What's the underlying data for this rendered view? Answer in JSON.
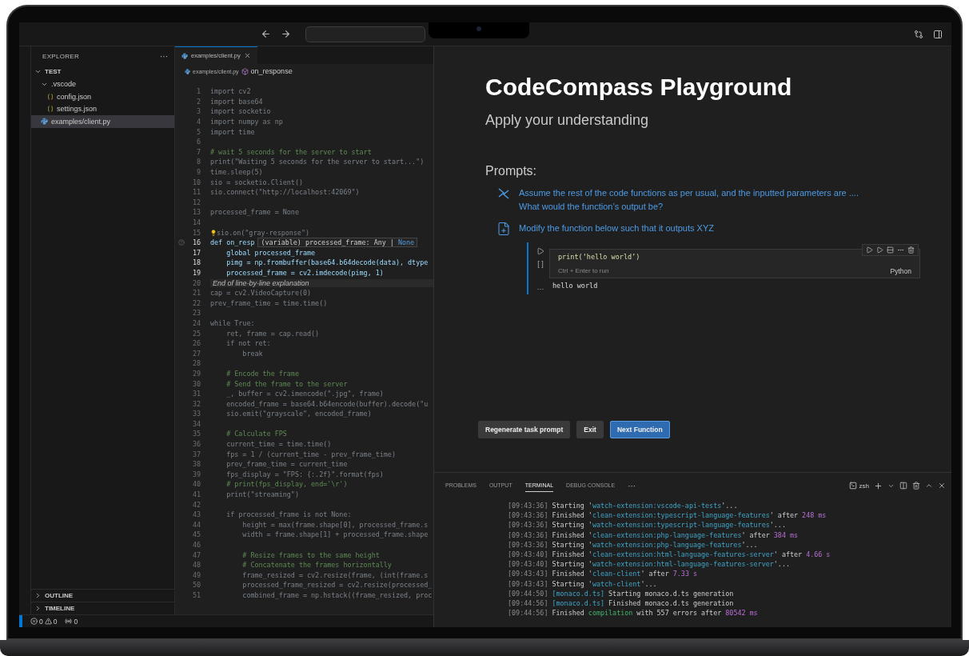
{
  "explorer": {
    "title": "EXPLORER",
    "more": "···",
    "tree": [
      {
        "label": "TEST",
        "kind": "root",
        "expanded": true,
        "selected": false,
        "children": [
          {
            "label": ".vscode",
            "kind": "folder",
            "expanded": true,
            "selected": false,
            "children": [
              {
                "label": "config.json",
                "kind": "json",
                "selected": false
              },
              {
                "label": "settings.json",
                "kind": "json",
                "selected": false
              }
            ]
          },
          {
            "label": "examples/client.py",
            "kind": "python",
            "selected": true
          }
        ]
      }
    ],
    "sections": [
      {
        "label": "OUTLINE",
        "expanded": false
      },
      {
        "label": "TIMELINE",
        "expanded": false
      }
    ]
  },
  "status_bar": {
    "errors": "0",
    "warnings": "0",
    "ports": "0"
  },
  "editor": {
    "tab": {
      "label": "examples/client.py",
      "selected": true
    },
    "breadcrumb": {
      "file": "examples/client.py",
      "symbol": "on_response"
    },
    "lines": [
      {
        "n": "1",
        "text": "import cv2",
        "kind": "code",
        "focus": false
      },
      {
        "n": "2",
        "text": "import base64",
        "kind": "code",
        "focus": false
      },
      {
        "n": "3",
        "text": "import socketio",
        "kind": "code",
        "focus": false
      },
      {
        "n": "4",
        "text": "import numpy as np",
        "kind": "code",
        "focus": false
      },
      {
        "n": "5",
        "text": "import time",
        "kind": "code",
        "focus": false
      },
      {
        "n": "6",
        "kind": "blank",
        "focus": false
      },
      {
        "n": "7",
        "text": "# wait 5 seconds for the server to start",
        "kind": "comment",
        "focus": false
      },
      {
        "n": "8",
        "text": "print(\"Waiting 5 seconds for the server to start...\")",
        "kind": "code",
        "focus": false
      },
      {
        "n": "9",
        "text": "time.sleep(5)",
        "kind": "code",
        "focus": false
      },
      {
        "n": "10",
        "text": "sio = socketio.Client()",
        "kind": "code",
        "focus": false
      },
      {
        "n": "11",
        "text": "sio.connect(\"http://localhost:42069\")",
        "kind": "code",
        "focus": false
      },
      {
        "n": "12",
        "kind": "blank",
        "focus": false
      },
      {
        "n": "13",
        "text": "processed_frame = None",
        "kind": "code",
        "focus": false
      },
      {
        "n": "14",
        "kind": "blank",
        "focus": false
      },
      {
        "n": "15",
        "text": "sio.on(\"gray-response\")",
        "kind": "bulb",
        "focus": false
      },
      {
        "n": "16",
        "text": "def on_resp",
        "kind": "hover",
        "focus": true,
        "hover_sig": "(variable) processed_frame: Any | ",
        "hover_type": "None"
      },
      {
        "n": "17",
        "text": "    global processed_frame",
        "kind": "code",
        "focus": true
      },
      {
        "n": "18",
        "text": "    pimg = np.frombuffer(base64.b64decode(data), dtype",
        "kind": "code",
        "focus": true
      },
      {
        "n": "19",
        "text": "    processed_frame = cv2.imdecode(pimg, 1)",
        "kind": "code",
        "focus": true
      },
      {
        "n": "20",
        "text": "End of line-by-line explanation",
        "kind": "banner",
        "focus": false
      },
      {
        "n": "21",
        "text": "cap = cv2.VideoCapture(0)",
        "kind": "code",
        "focus": false
      },
      {
        "n": "22",
        "text": "prev_frame_time = time.time()",
        "kind": "code",
        "focus": false
      },
      {
        "n": "23",
        "kind": "blank",
        "focus": false
      },
      {
        "n": "24",
        "text": "while True:",
        "kind": "code",
        "focus": false
      },
      {
        "n": "25",
        "text": "    ret, frame = cap.read()",
        "kind": "code",
        "focus": false
      },
      {
        "n": "26",
        "text": "    if not ret:",
        "kind": "code",
        "focus": false
      },
      {
        "n": "27",
        "text": "        break",
        "kind": "code",
        "focus": false
      },
      {
        "n": "28",
        "kind": "blank",
        "focus": false
      },
      {
        "n": "29",
        "text": "    # Encode the frame",
        "kind": "comment",
        "focus": false
      },
      {
        "n": "30",
        "text": "    # Send the frame to the server",
        "kind": "comment",
        "focus": false
      },
      {
        "n": "31",
        "text": "    _, buffer = cv2.imencode(\".jpg\", frame)",
        "kind": "code",
        "focus": false
      },
      {
        "n": "32",
        "text": "    encoded_frame = base64.b64encode(buffer).decode(\"u",
        "kind": "code",
        "focus": false
      },
      {
        "n": "33",
        "text": "    sio.emit(\"grayscale\", encoded_frame)",
        "kind": "code",
        "focus": false
      },
      {
        "n": "34",
        "kind": "blank",
        "focus": false
      },
      {
        "n": "35",
        "text": "    # Calculate FPS",
        "kind": "comment",
        "focus": false
      },
      {
        "n": "36",
        "text": "    current_time = time.time()",
        "kind": "code",
        "focus": false
      },
      {
        "n": "37",
        "text": "    fps = 1 / (current_time - prev_frame_time)",
        "kind": "code",
        "focus": false
      },
      {
        "n": "38",
        "text": "    prev_frame_time = current_time",
        "kind": "code",
        "focus": false
      },
      {
        "n": "39",
        "text": "    fps_display = \"FPS: {:.2f}\".format(fps)",
        "kind": "code",
        "focus": false
      },
      {
        "n": "40",
        "text": "    # print(fps_display, end='\\r')",
        "kind": "comment",
        "focus": false
      },
      {
        "n": "41",
        "text": "    print(\"streaming\")",
        "kind": "code",
        "focus": false
      },
      {
        "n": "42",
        "kind": "blank",
        "focus": false
      },
      {
        "n": "43",
        "text": "    if processed_frame is not None:",
        "kind": "code",
        "focus": false
      },
      {
        "n": "44",
        "text": "        height = max(frame.shape[0], processed_frame.s",
        "kind": "code",
        "focus": false
      },
      {
        "n": "45",
        "text": "        width = frame.shape[1] + processed_frame.shape",
        "kind": "code",
        "focus": false
      },
      {
        "n": "46",
        "kind": "blank",
        "focus": false
      },
      {
        "n": "47",
        "text": "        # Resize frames to the same height",
        "kind": "comment",
        "focus": false
      },
      {
        "n": "48",
        "text": "        # Concatenate the frames horizontally",
        "kind": "comment",
        "focus": false
      },
      {
        "n": "49",
        "text": "        frame_resized = cv2.resize(frame, (int(frame.s",
        "kind": "code",
        "focus": false
      },
      {
        "n": "50",
        "text": "        processed_frame_resized = cv2.resize(processed_",
        "kind": "code",
        "focus": false
      },
      {
        "n": "51",
        "text": "        combined_frame = np.hstack((frame_resized, proc",
        "kind": "code",
        "focus": false
      }
    ]
  },
  "playground": {
    "title": "CodeCompass Playground",
    "subtitle": "Apply your understanding",
    "prompts_label": "Prompts:",
    "prompts": [
      {
        "kind": "arrows",
        "lines": [
          "Assume the rest of the code functions as per usual, and the inputted parameters are ....",
          "What would the function’s output be?"
        ]
      },
      {
        "kind": "file",
        "lines": [
          "Modify the function below such that it outputs XYZ"
        ]
      }
    ],
    "cell": {
      "code": "print(‘hello world’)",
      "exec": "[ ]",
      "hint": "Ctrl + Enter to run",
      "language": "Python",
      "output_marker": "···",
      "output": "hello world"
    },
    "buttons": [
      {
        "label": "Regenerate task prompt",
        "kind": "secondary"
      },
      {
        "label": "Exit",
        "kind": "secondary"
      },
      {
        "label": "Next Function",
        "kind": "primary"
      }
    ]
  },
  "panel": {
    "tabs": [
      {
        "label": "PROBLEMS",
        "selected": false
      },
      {
        "label": "OUTPUT",
        "selected": false
      },
      {
        "label": "TERMINAL",
        "selected": true
      },
      {
        "label": "DEBUG CONSOLE",
        "selected": false
      }
    ],
    "more": "···",
    "shell": "zsh",
    "lines": [
      {
        "time": "[09:43:36]",
        "parts": [
          {
            "t": " Starting '",
            "kind": "plain"
          },
          {
            "t": "watch-extension:vscode-api-tests",
            "kind": "name"
          },
          {
            "t": "'...",
            "kind": "plain"
          }
        ]
      },
      {
        "time": "[09:43:36]",
        "parts": [
          {
            "t": " Finished '",
            "kind": "plain"
          },
          {
            "t": "clean-extension:typescript-language-features",
            "kind": "name"
          },
          {
            "t": "' after ",
            "kind": "plain"
          },
          {
            "t": "248 ms",
            "kind": "num"
          }
        ]
      },
      {
        "time": "[09:43:36]",
        "parts": [
          {
            "t": " Starting '",
            "kind": "plain"
          },
          {
            "t": "watch-extension:typescript-language-features",
            "kind": "name"
          },
          {
            "t": "'...",
            "kind": "plain"
          }
        ]
      },
      {
        "time": "[09:43:36]",
        "parts": [
          {
            "t": " Finished '",
            "kind": "plain"
          },
          {
            "t": "clean-extension:php-language-features",
            "kind": "name"
          },
          {
            "t": "' after ",
            "kind": "plain"
          },
          {
            "t": "384 ms",
            "kind": "num"
          }
        ]
      },
      {
        "time": "[09:43:36]",
        "parts": [
          {
            "t": " Starting '",
            "kind": "plain"
          },
          {
            "t": "watch-extension:php-language-features",
            "kind": "name"
          },
          {
            "t": "'...",
            "kind": "plain"
          }
        ]
      },
      {
        "time": "[09:43:40]",
        "parts": [
          {
            "t": " Finished '",
            "kind": "plain"
          },
          {
            "t": "clean-extension:html-language-features-server",
            "kind": "name"
          },
          {
            "t": "' after ",
            "kind": "plain"
          },
          {
            "t": "4.66 s",
            "kind": "num"
          }
        ]
      },
      {
        "time": "[09:43:40]",
        "parts": [
          {
            "t": " Starting '",
            "kind": "plain"
          },
          {
            "t": "watch-extension:html-language-features-server",
            "kind": "name"
          },
          {
            "t": "'...",
            "kind": "plain"
          }
        ]
      },
      {
        "time": "[09:43:43]",
        "parts": [
          {
            "t": " Finished '",
            "kind": "plain"
          },
          {
            "t": "clean-client",
            "kind": "name"
          },
          {
            "t": "' after ",
            "kind": "plain"
          },
          {
            "t": "7.33 s",
            "kind": "num"
          }
        ]
      },
      {
        "time": "[09:43:43]",
        "parts": [
          {
            "t": " Starting '",
            "kind": "plain"
          },
          {
            "t": "watch-client",
            "kind": "name"
          },
          {
            "t": "'...",
            "kind": "plain"
          }
        ]
      },
      {
        "time": "[09:44:50]",
        "parts": [
          {
            "t": " [monaco.d.ts]",
            "kind": "name"
          },
          {
            "t": " Starting monaco.d.ts generation",
            "kind": "plain"
          }
        ]
      },
      {
        "time": "[09:44:56]",
        "parts": [
          {
            "t": " [monaco.d.ts]",
            "kind": "name"
          },
          {
            "t": " Finished monaco.d.ts generation",
            "kind": "plain"
          }
        ]
      },
      {
        "time": "[09:44:56]",
        "parts": [
          {
            "t": " Finished ",
            "kind": "plain"
          },
          {
            "t": "compilation",
            "kind": "ok"
          },
          {
            "t": " with 557 errors after ",
            "kind": "plain"
          },
          {
            "t": "80542 ms",
            "kind": "num"
          }
        ]
      }
    ]
  }
}
